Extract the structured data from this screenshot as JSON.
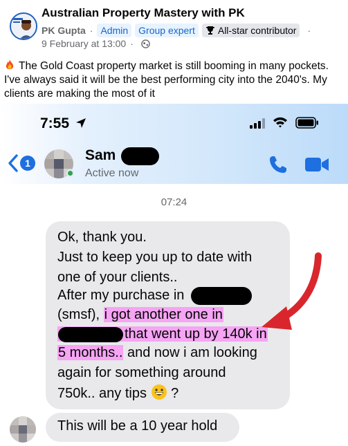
{
  "post": {
    "group_name": "Australian Property Mastery with PK",
    "author": "PK Gupta",
    "badges": [
      "Admin",
      "Group expert",
      "All-star contributor"
    ],
    "date": "9 February at 13:00",
    "audience_icon": "globe-icon",
    "text": "The Gold Coast property market is still booming in many pockets. I've always said it will be the best performing city into the 2040's. My clients are making the most of it",
    "lead_icon": "fire-emoji"
  },
  "screenshot": {
    "status_bar": {
      "time": "7:55",
      "icons": [
        "location-arrow-icon",
        "signal-icon",
        "wifi-icon",
        "battery-icon"
      ]
    },
    "chat_header": {
      "back_count": "1",
      "contact_name": "Sam",
      "status": "Active now",
      "actions": [
        "phone-icon",
        "video-icon"
      ]
    },
    "timestamp": "07:24",
    "message_lines": [
      "Ok, thank you.",
      "Just to keep you up to date with",
      "one of your clients..",
      "After my purchase in",
      "(smsf),",
      "i got another one in",
      "that went up by 140k in",
      "5 months..",
      "and now i am looking",
      "again for something around",
      "750k.. any tips",
      "?"
    ],
    "second_message": "This will be a 10 year hold",
    "colors": {
      "highlight": "#f6a4f4",
      "arrow": "#d9262c",
      "messenger_blue": "#1e6fe0",
      "bubble": "#e9e9eb"
    }
  }
}
